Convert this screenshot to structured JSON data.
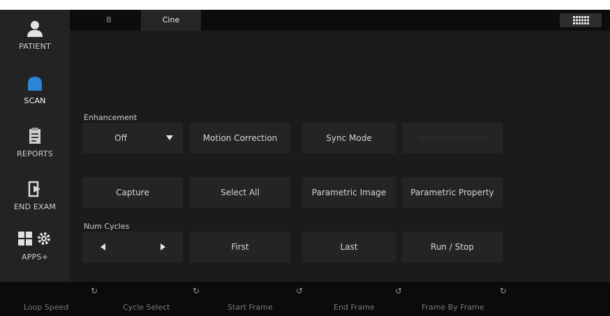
{
  "sidebar": {
    "items": [
      {
        "label": "PATIENT",
        "icon": "patient-icon"
      },
      {
        "label": "SCAN",
        "icon": "probe-icon",
        "active": true
      },
      {
        "label": "REPORTS",
        "icon": "reports-icon"
      },
      {
        "label": "END EXAM",
        "icon": "exit-icon"
      },
      {
        "label": "APPS+",
        "icon": "apps-gear-icon"
      }
    ]
  },
  "tabs": [
    {
      "label": "B"
    },
    {
      "label": "Cine",
      "active": true
    }
  ],
  "main": {
    "enhancement": {
      "label": "Enhancement",
      "value": "Off"
    },
    "row1_buttons": [
      "Motion Correction",
      "Sync Mode",
      "Synchronization"
    ],
    "row2_buttons": [
      "Capture",
      "Select All",
      "Parametric Image",
      "Parametric Property"
    ],
    "num_cycles": {
      "label": "Num Cycles"
    },
    "row3_buttons": [
      "First",
      "Last",
      "Run / Stop"
    ]
  },
  "bottom_knobs": [
    {
      "label": "Loop Speed"
    },
    {
      "label": "Cycle Select"
    },
    {
      "label": "Start Frame"
    },
    {
      "label": "End Frame"
    },
    {
      "label": "Frame By Frame"
    }
  ],
  "colors": {
    "accent_blue": "#2a86d6",
    "panel_bg": "#1b1b1b",
    "button_bg": "#242424"
  }
}
